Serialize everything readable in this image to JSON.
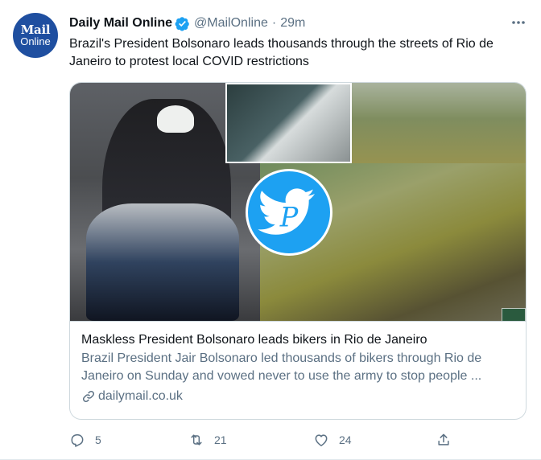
{
  "avatar": {
    "line1": "Mail",
    "line2": "Online",
    "color": "#1f4fa0"
  },
  "tweet": {
    "display_name": "Daily Mail Online",
    "handle": "@MailOnline",
    "separator": "·",
    "time": "29m",
    "verified": true,
    "text": "Brazil's President Bolsonaro leads thousands through the streets of Rio de Janeiro to protest local COVID restrictions"
  },
  "card": {
    "title": "Maskless President Bolsonaro leads bikers in Rio de Janeiro",
    "description": "Brazil President Jair Bolsonaro led thousands of bikers through Rio de Janeiro on Sunday and vowed never to use the army to stop people ...",
    "domain": "dailymail.co.uk"
  },
  "actions": {
    "reply_count": "5",
    "retweet_count": "21",
    "like_count": "24"
  },
  "icons": {
    "more": "more-icon",
    "verified": "verified-badge-icon",
    "reply": "reply-icon",
    "retweet": "retweet-icon",
    "like": "like-icon",
    "share": "share-icon",
    "link": "link-icon",
    "watermark": "twitter-bird-p-logo-icon"
  },
  "colors": {
    "accent": "#1da1f2",
    "secondary_text": "#5b7083",
    "primary_text": "#0f1419",
    "border": "#cfd9de"
  }
}
